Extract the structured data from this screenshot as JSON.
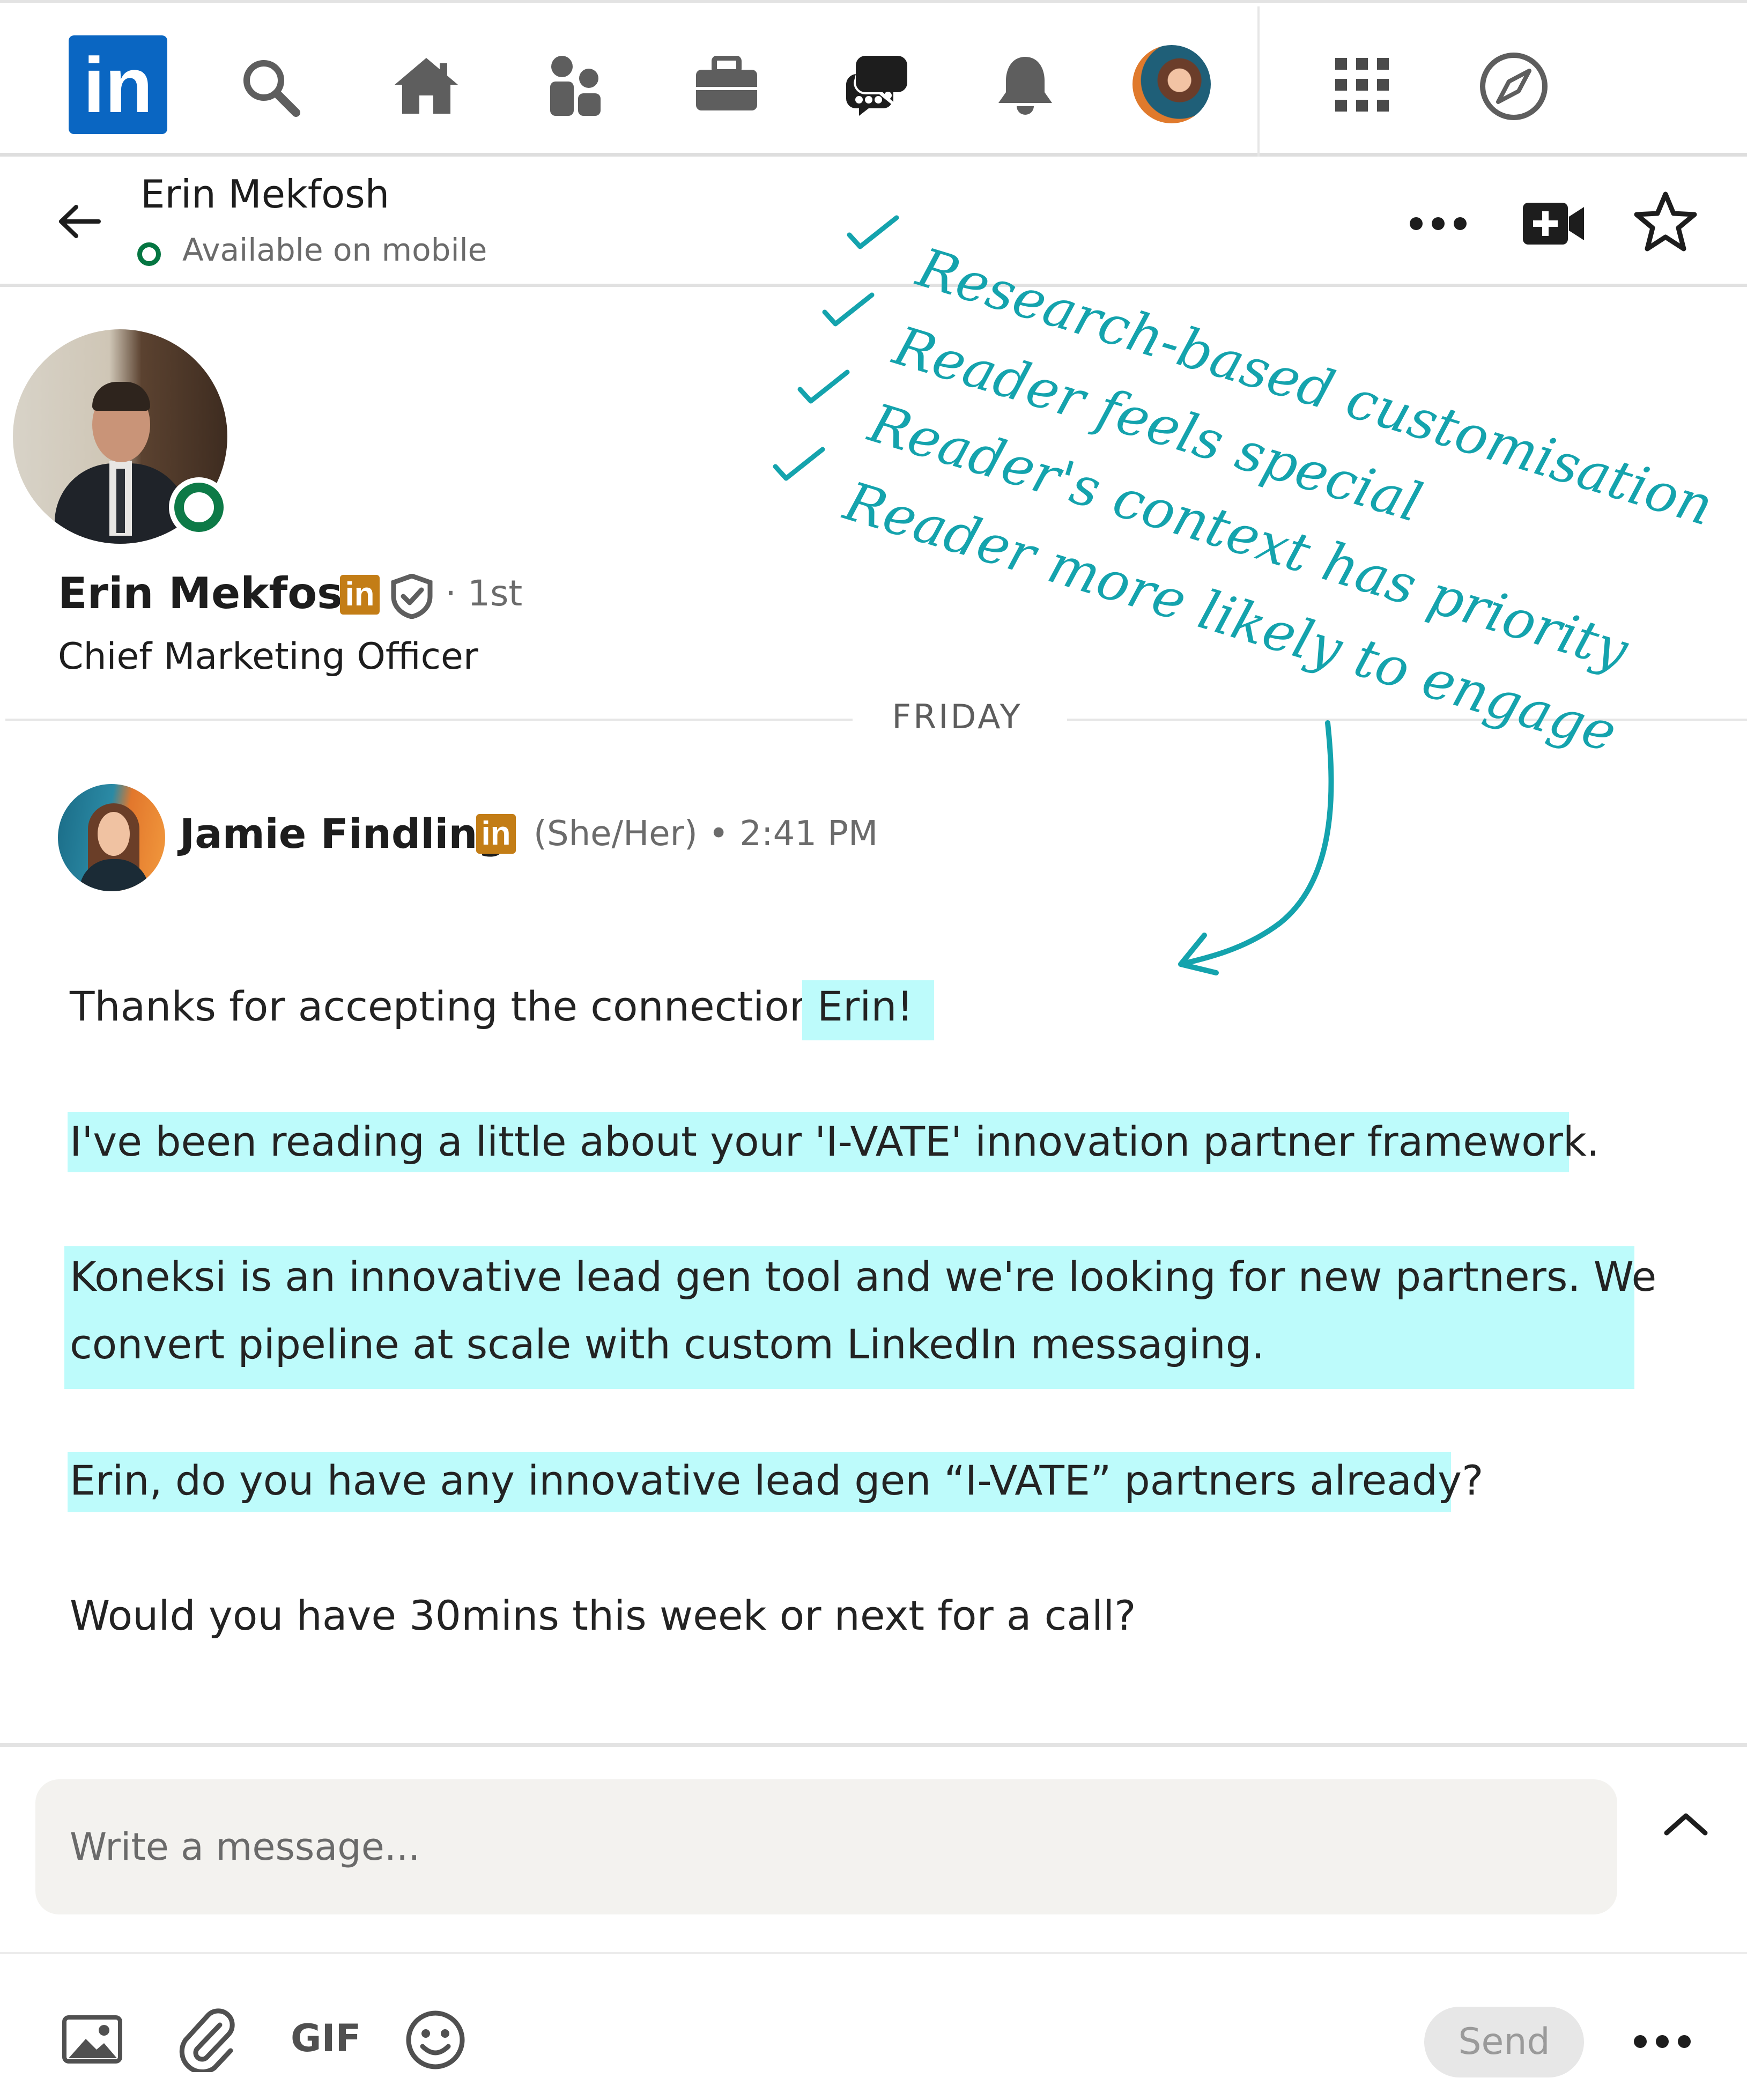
{
  "nav": {
    "logo_text": "in",
    "icons": [
      "search-icon",
      "home-icon",
      "my-network-icon",
      "jobs-briefcase-icon",
      "messaging-icon",
      "notifications-bell-icon",
      "me-avatar",
      "apps-grid-icon",
      "explore-compass-icon"
    ]
  },
  "conversation": {
    "name": "Erin Mekfosh",
    "status": "Available on mobile"
  },
  "profile": {
    "name": "Erin Mekfosh",
    "degree": "· 1st",
    "title": "Chief Marketing Officer"
  },
  "thread": {
    "day_label": "FRIDAY",
    "sender": {
      "name": "Jamie Findling",
      "meta": "(She/Her) • 2:41 PM"
    },
    "lines": {
      "l1_plain": "Thanks for accepting the connection,",
      "l1_highlight": "Erin!",
      "l2": "I've been reading a little about your 'I-VATE' innovation partner framework.",
      "l3a": "Koneksi is an innovative lead gen tool and we're looking for new partners. We",
      "l3b": "convert pipeline at scale with custom LinkedIn messaging.",
      "l4": "Erin, do you have any innovative lead gen “I-VATE” partners already?",
      "l5": "Would you have 30mins this week or next for a call?"
    }
  },
  "annotations": [
    "Research-based customisation",
    "Reader feels special",
    "Reader's context has priority",
    "Reader more likely to engage"
  ],
  "composer": {
    "placeholder": "Write a message...",
    "gif_label": "GIF",
    "send_label": "Send"
  },
  "colors": {
    "linkedin_blue": "#0a66c2",
    "highlight": "#bdfbfb",
    "annotation_teal": "#14a3ad",
    "online_green": "#057642",
    "premium_gold": "#c37d16"
  }
}
